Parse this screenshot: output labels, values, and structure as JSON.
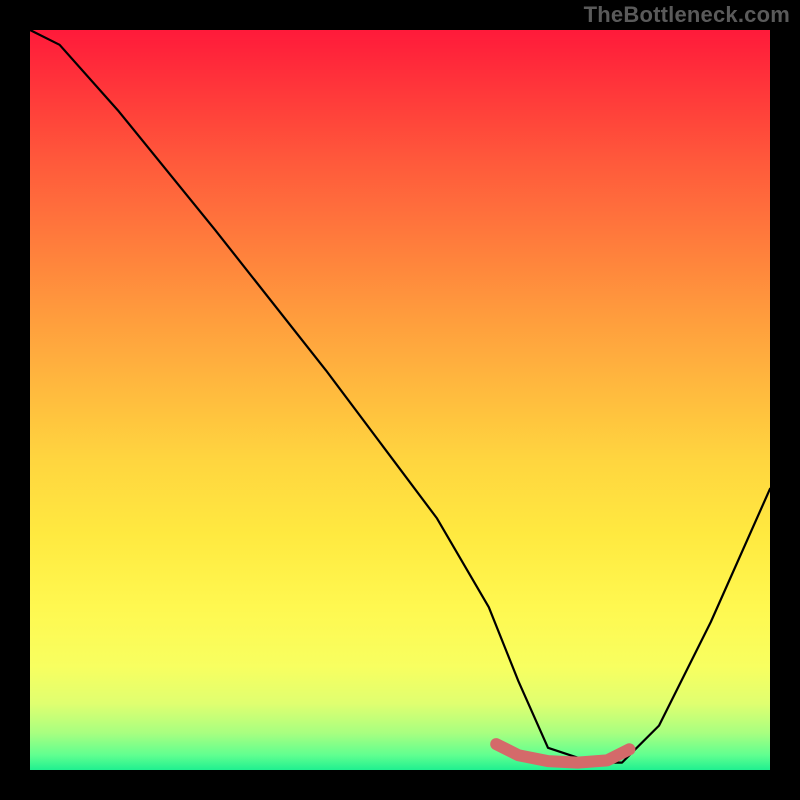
{
  "watermark": "TheBottleneck.com",
  "chart_data": {
    "type": "line",
    "title": "",
    "xlabel": "",
    "ylabel": "",
    "xlim": [
      0,
      100
    ],
    "ylim": [
      0,
      100
    ],
    "series": [
      {
        "name": "bottleneck-curve",
        "x": [
          0,
          4,
          12,
          25,
          40,
          55,
          62,
          66,
          70,
          76,
          80,
          85,
          92,
          100
        ],
        "values": [
          100,
          98,
          89,
          73,
          54,
          34,
          22,
          12,
          3,
          1,
          1,
          6,
          20,
          38
        ]
      }
    ],
    "highlight_region": {
      "name": "optimal-range",
      "x": [
        63,
        66,
        70,
        74,
        78,
        81
      ],
      "values": [
        3.5,
        2.0,
        1.2,
        1.0,
        1.3,
        2.8
      ]
    },
    "gradient_stops": [
      {
        "pct": 0,
        "color": "#ff1a3a"
      },
      {
        "pct": 50,
        "color": "#ffd53f"
      },
      {
        "pct": 95,
        "color": "#a8ff80"
      },
      {
        "pct": 100,
        "color": "#20f090"
      }
    ]
  }
}
